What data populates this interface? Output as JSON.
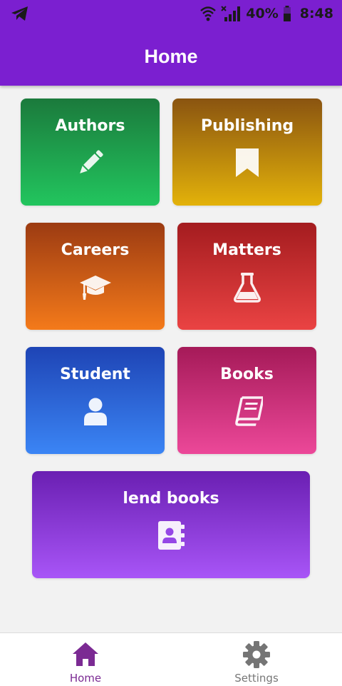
{
  "status_bar": {
    "battery_percent": "40%",
    "time": "8:48"
  },
  "header": {
    "title": "Home"
  },
  "cards": {
    "authors": {
      "label": "Authors",
      "icon": "pencil-icon"
    },
    "publishing": {
      "label": "Publishing",
      "icon": "bookmark-icon"
    },
    "careers": {
      "label": "Careers",
      "icon": "graduation-cap-icon"
    },
    "matters": {
      "label": "Matters",
      "icon": "flask-icon"
    },
    "student": {
      "label": "Student",
      "icon": "user-icon"
    },
    "books": {
      "label": "Books",
      "icon": "book-icon"
    },
    "lend_books": {
      "label": "lend books",
      "icon": "address-book-icon"
    }
  },
  "bottom_nav": {
    "home": {
      "label": "Home",
      "icon": "home-icon",
      "active": true,
      "color": "#7b2a93"
    },
    "settings": {
      "label": "Settings",
      "icon": "gear-icon",
      "active": false,
      "color": "#777777"
    }
  },
  "colors": {
    "app_bar": "#7b1fd0",
    "background": "#f2f2f2"
  }
}
